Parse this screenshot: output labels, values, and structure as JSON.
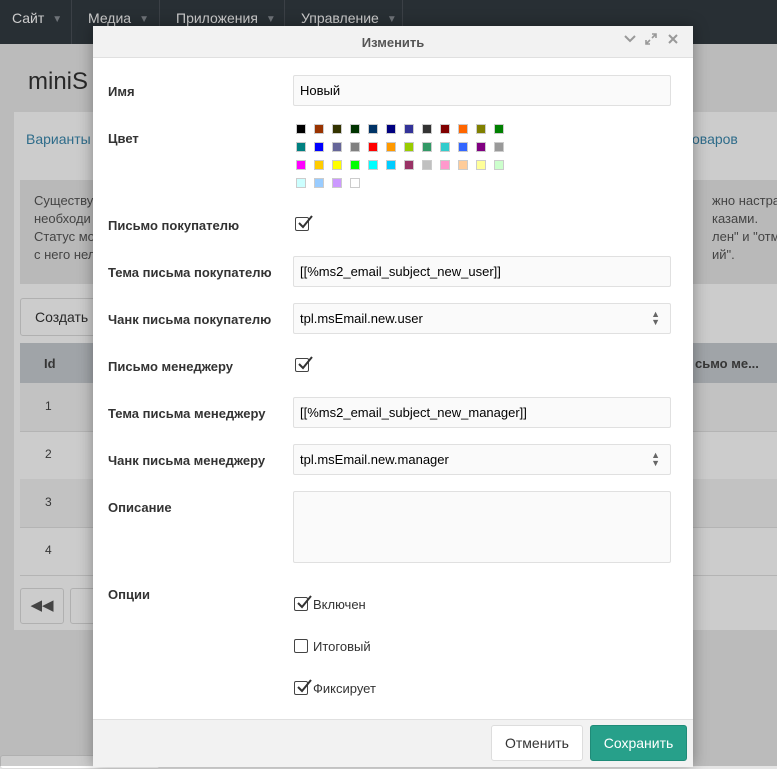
{
  "nav": {
    "items": [
      {
        "label": "Сайт"
      },
      {
        "label": "Медиа"
      },
      {
        "label": "Приложения"
      },
      {
        "label": "Управление"
      }
    ]
  },
  "background": {
    "page_title": "miniS",
    "tab_left": "Варианты",
    "tab_right": "оваров",
    "notice_left": [
      "Существу",
      "необходи",
      "Статус мо",
      "с него нел"
    ],
    "notice_right": [
      "жно настраи",
      "казами.",
      "лен\" и \"отмен",
      "ий\"."
    ],
    "create_button": "Создать",
    "table_header": {
      "id": "Id",
      "right": "сьмо ме..."
    },
    "rows": [
      "1",
      "2",
      "3",
      "4"
    ],
    "first_page_icon": "double-left-arrow-icon"
  },
  "modal": {
    "title": "Изменить",
    "tools": [
      "chevron-down-icon",
      "expand-icon",
      "close-icon"
    ],
    "fields": {
      "name_label": "Имя",
      "name_value": "Новый",
      "color_label": "Цвет",
      "email_user_label": "Письмо покупателю",
      "email_user_checked": true,
      "subject_user_label": "Тема письма покупателю",
      "subject_user_value": "[[%ms2_email_subject_new_user]]",
      "chunk_user_label": "Чанк письма покупателю",
      "chunk_user_value": "tpl.msEmail.new.user",
      "email_manager_label": "Письмо менеджеру",
      "email_manager_checked": true,
      "subject_manager_label": "Тема письма менеджеру",
      "subject_manager_value": "[[%ms2_email_subject_new_manager]]",
      "chunk_manager_label": "Чанк письма менеджеру",
      "chunk_manager_value": "tpl.msEmail.new.manager",
      "description_label": "Описание",
      "description_value": "",
      "options_label": "Опции",
      "options": [
        {
          "label": "Включен",
          "checked": true
        },
        {
          "label": "Итоговый",
          "checked": false
        },
        {
          "label": "Фиксирует",
          "checked": true
        }
      ]
    },
    "palette": [
      "#000000",
      "#993300",
      "#333300",
      "#003300",
      "#003366",
      "#000080",
      "#333399",
      "#333333",
      "#800000",
      "#FF6600",
      "#808000",
      "#008000",
      "#008080",
      "#0000FF",
      "#666699",
      "#808080",
      "#FF0000",
      "#FF9900",
      "#99CC00",
      "#339966",
      "#33CCCC",
      "#3366FF",
      "#800080",
      "#999999",
      "#FF00FF",
      "#FFCC00",
      "#FFFF00",
      "#00FF00",
      "#00FFFF",
      "#00CCFF",
      "#993366",
      "#C0C0C0",
      "#FF99CC",
      "#FFCC99",
      "#FFFF99",
      "#CCFFCC",
      "#CCFFFF",
      "#99CCFF",
      "#CC99FF",
      "#FFFFFF"
    ],
    "buttons": {
      "cancel": "Отменить",
      "save": "Сохранить"
    }
  }
}
